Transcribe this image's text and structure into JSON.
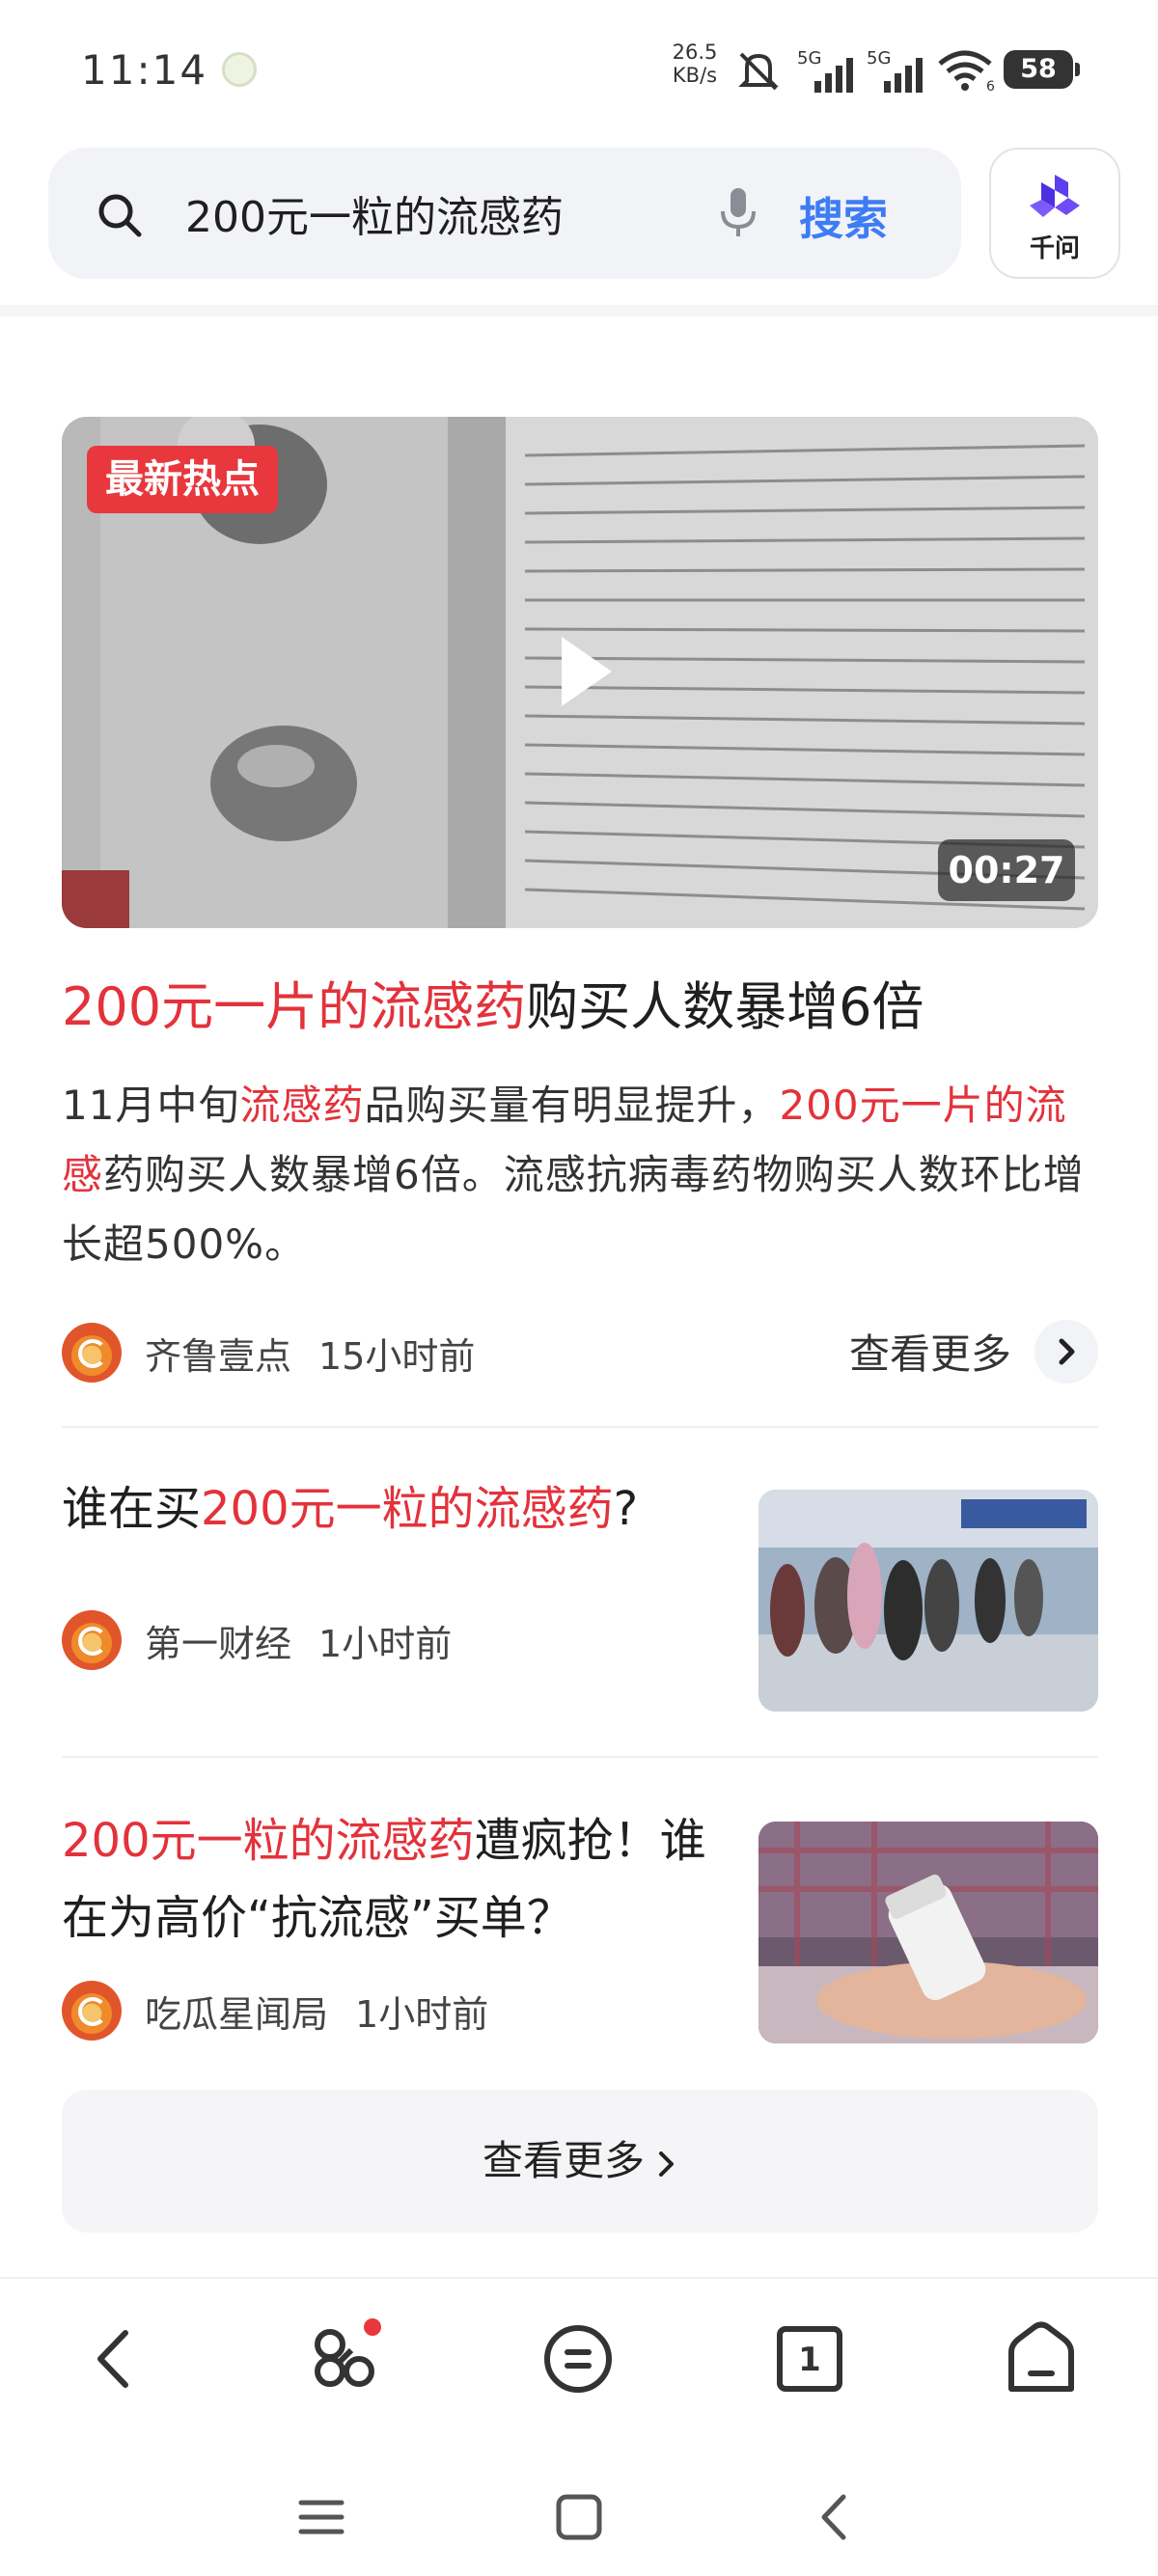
{
  "status_bar": {
    "time": "11:14",
    "net_speed_value": "26.5",
    "net_speed_unit": "KB/s",
    "sim1_label": "5G",
    "sim2_label": "5G",
    "wifi_sub": "6",
    "battery": "58"
  },
  "search": {
    "query": "200元一粒的流感药",
    "button_label": "搜索",
    "assistant_label": "千问"
  },
  "video_card": {
    "badge": "最新热点",
    "duration": "00:27",
    "headline_parts": [
      "200元一片",
      "的流感药",
      "购买人数暴增6倍"
    ],
    "summary_parts": [
      "11月中旬",
      "流感药",
      "品购买量有明显提升，",
      "200元一片",
      "的流感",
      "药购买人数暴增6倍。流感抗病毒药物购买人数环比增长超500%。"
    ],
    "source": "齐鲁壹点",
    "time": "15小时前",
    "more_label": "查看更多"
  },
  "news": [
    {
      "title_parts": [
        "谁在买",
        "200元一粒的流感药",
        "?"
      ],
      "source": "第一财经",
      "time": "1小时前",
      "image_icon": "hospital-crowd-photo"
    },
    {
      "title_parts": [
        "200元一粒的流感药",
        "遭疯抢！谁在为高价“抗流感”买单？"
      ],
      "source": "吃瓜星闻局",
      "time": "1小时前",
      "image_icon": "pill-bottle-hand-photo"
    }
  ],
  "more_button_label": "查看更多",
  "colors": {
    "accent_red": "#e3323b",
    "accent_blue": "#3e7cf4",
    "badge_red": "#e8383d"
  },
  "bottom_nav_icons": [
    "back-icon",
    "discover-icon",
    "menu-icon",
    "tabs-icon",
    "home-icon"
  ],
  "tabs_count": "1"
}
